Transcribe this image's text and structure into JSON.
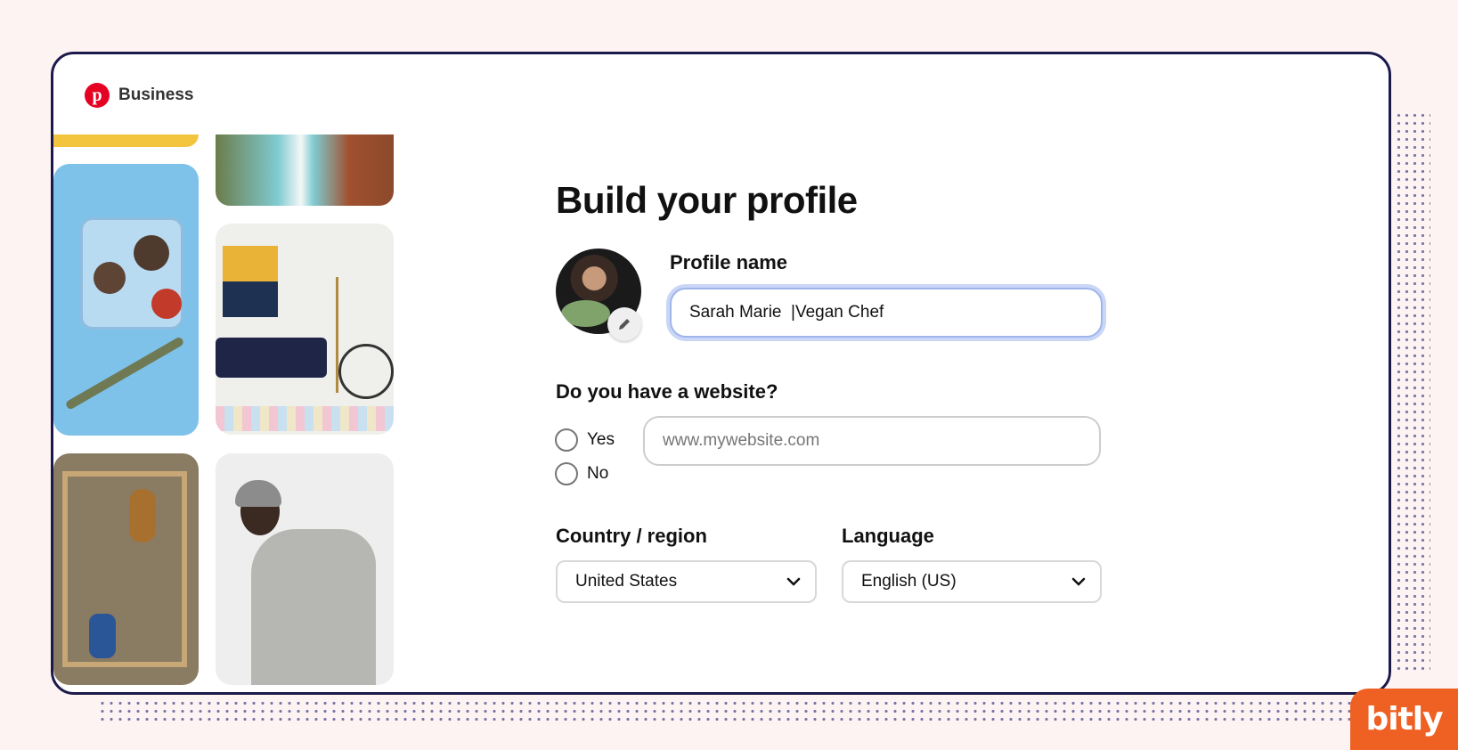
{
  "brand": {
    "name": "Business",
    "logo_letter": "p"
  },
  "form": {
    "title": "Build your profile",
    "profile_name_label": "Profile name",
    "profile_name_value": "Sarah Marie  |Vegan Chef",
    "website_question": "Do you have a website?",
    "radio_yes": "Yes",
    "radio_no": "No",
    "website_placeholder": "www.mywebsite.com",
    "country_label": "Country / region",
    "country_value": "United States",
    "language_label": "Language",
    "language_value": "English (US)"
  },
  "badge": {
    "text": "bitly"
  },
  "colors": {
    "brand_red": "#e60023",
    "focus_blue": "#9fb5ea",
    "frame": "#1c1a4a",
    "bitly_orange": "#ee6123",
    "background": "#fdf3f2"
  },
  "icons": [
    "pinterest-logo-icon",
    "pencil-icon",
    "chevron-down-icon"
  ]
}
